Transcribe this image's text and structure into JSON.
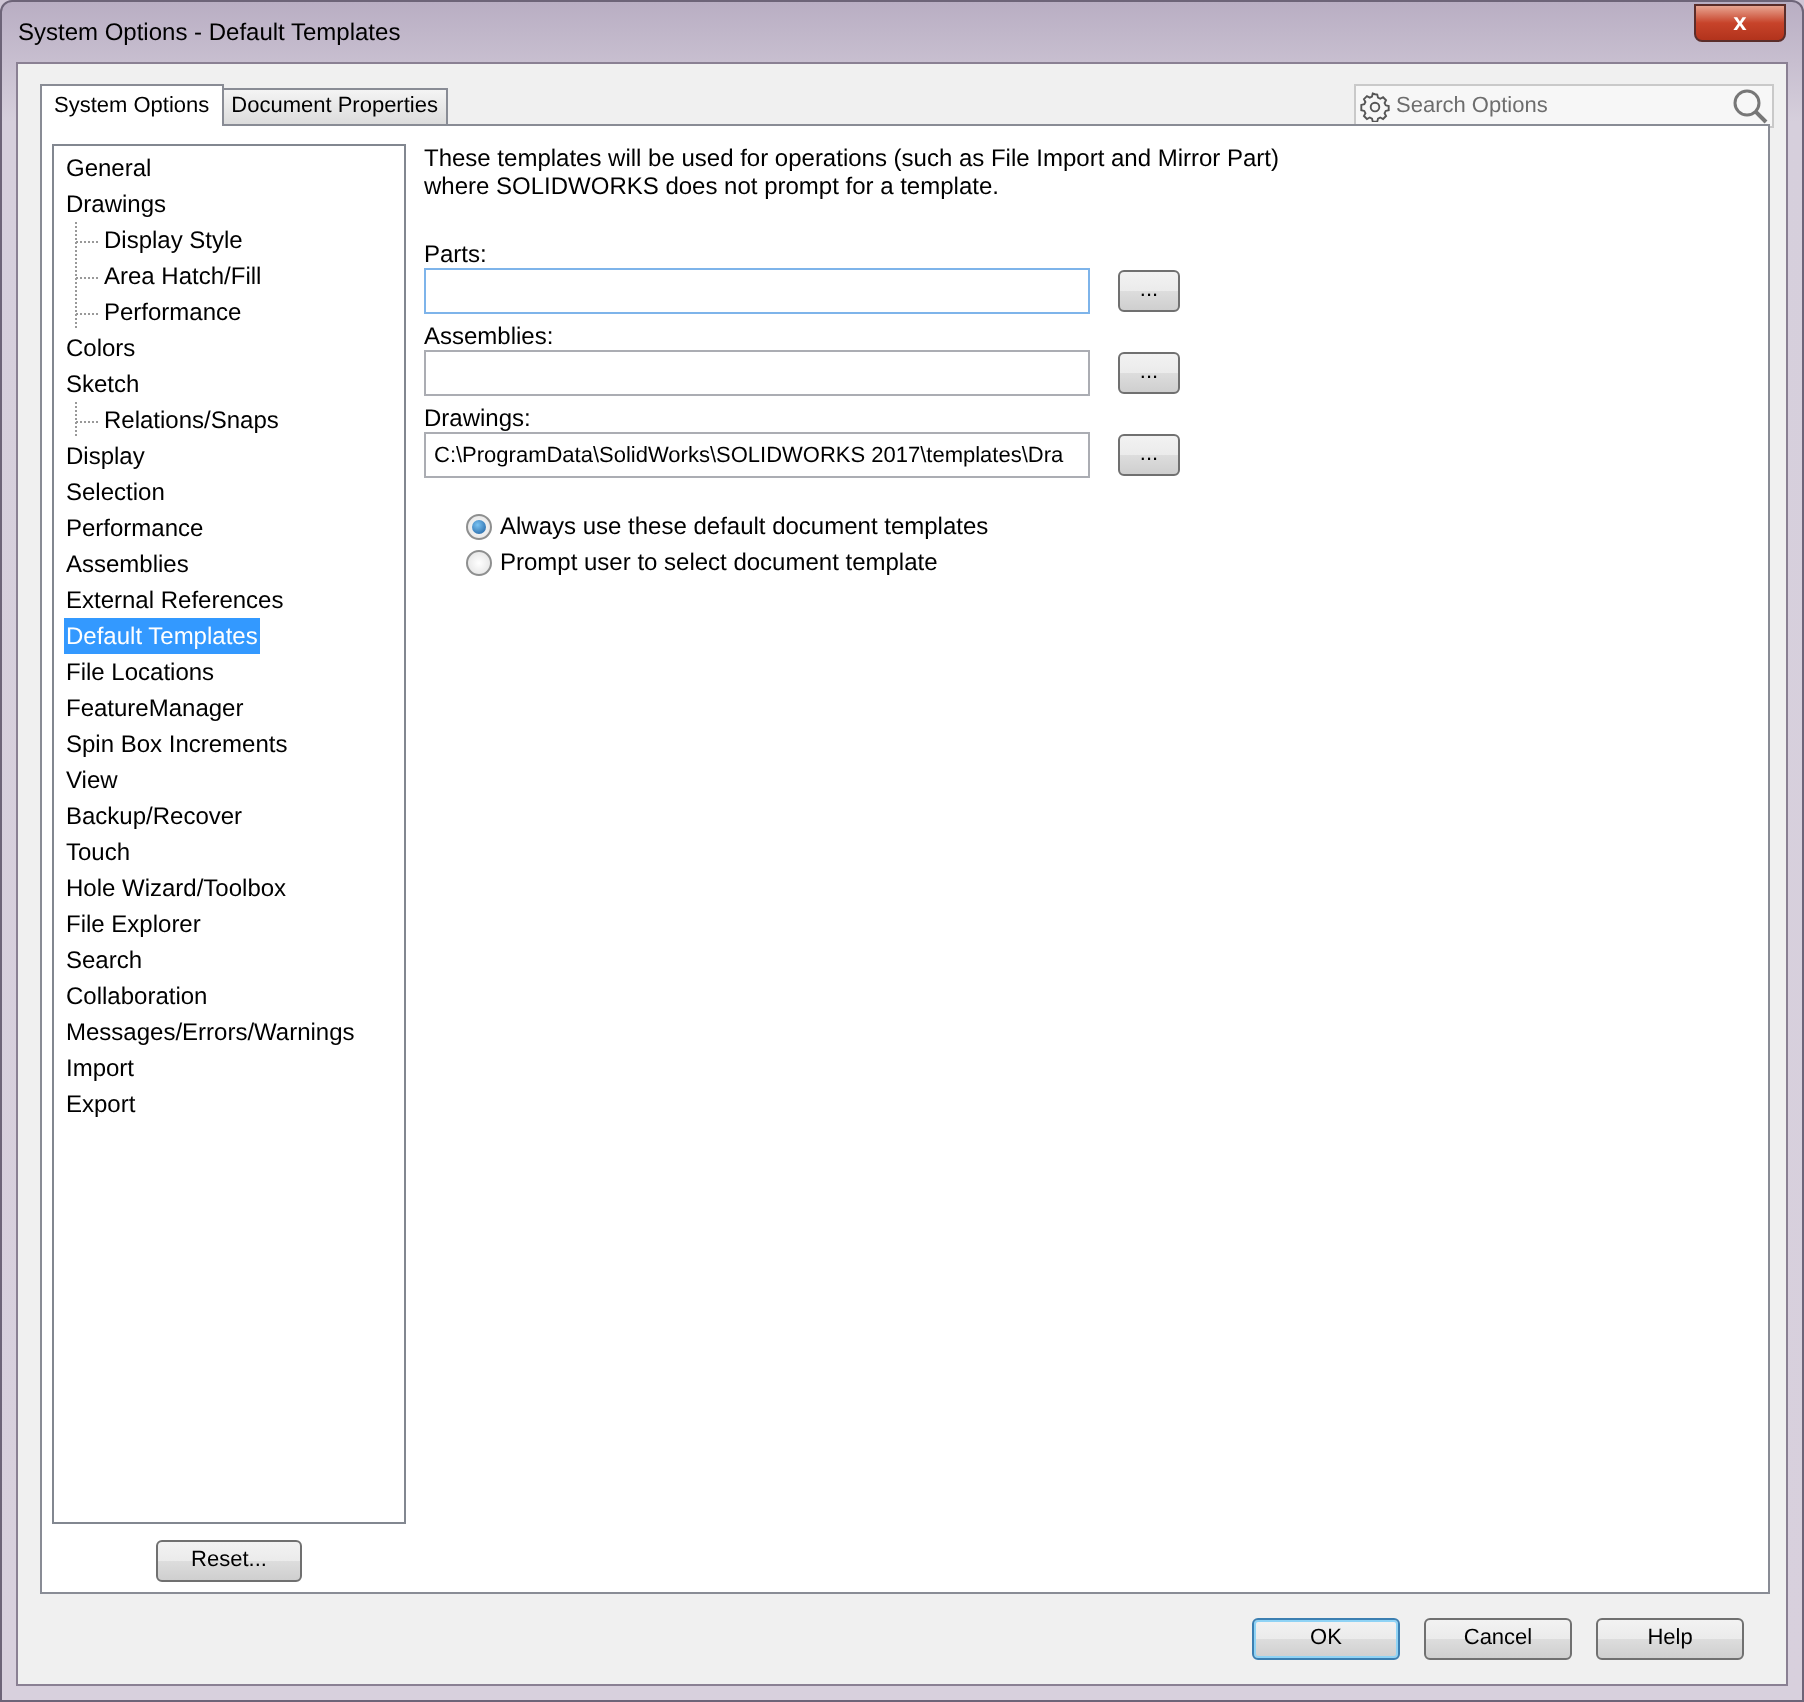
{
  "window": {
    "title": "System Options - Default Templates",
    "close_label": "x"
  },
  "tabs": [
    {
      "label": "System Options",
      "selected": true
    },
    {
      "label": "Document Properties",
      "selected": false
    }
  ],
  "search": {
    "placeholder": "Search Options"
  },
  "tree": [
    {
      "label": "General",
      "selected": false
    },
    {
      "label": "Drawings",
      "selected": false,
      "children": [
        {
          "label": "Display Style",
          "selected": false
        },
        {
          "label": "Area Hatch/Fill",
          "selected": false
        },
        {
          "label": "Performance",
          "selected": false
        }
      ]
    },
    {
      "label": "Colors",
      "selected": false
    },
    {
      "label": "Sketch",
      "selected": false,
      "children": [
        {
          "label": "Relations/Snaps",
          "selected": false
        }
      ]
    },
    {
      "label": "Display",
      "selected": false
    },
    {
      "label": "Selection",
      "selected": false
    },
    {
      "label": "Performance",
      "selected": false
    },
    {
      "label": "Assemblies",
      "selected": false
    },
    {
      "label": "External References",
      "selected": false
    },
    {
      "label": "Default Templates",
      "selected": true
    },
    {
      "label": "File Locations",
      "selected": false
    },
    {
      "label": "FeatureManager",
      "selected": false
    },
    {
      "label": "Spin Box Increments",
      "selected": false
    },
    {
      "label": "View",
      "selected": false
    },
    {
      "label": "Backup/Recover",
      "selected": false
    },
    {
      "label": "Touch",
      "selected": false
    },
    {
      "label": "Hole Wizard/Toolbox",
      "selected": false
    },
    {
      "label": "File Explorer",
      "selected": false
    },
    {
      "label": "Search",
      "selected": false
    },
    {
      "label": "Collaboration",
      "selected": false
    },
    {
      "label": "Messages/Errors/Warnings",
      "selected": false
    },
    {
      "label": "Import",
      "selected": false
    },
    {
      "label": "Export",
      "selected": false
    }
  ],
  "reset_button": "Reset...",
  "description": "These templates will be used for operations (such as File Import and Mirror Part)\nwhere SOLIDWORKS does not prompt for a template.",
  "fields": [
    {
      "label": "Parts:",
      "focused": true,
      "browse": "..."
    },
    {
      "label": "Assemblies:",
      "focused": false,
      "browse": "..."
    },
    {
      "label": "Drawings:",
      "value": "C:\\ProgramData\\SolidWorks\\SOLIDWORKS 2017\\templates\\Dra",
      "focused": false,
      "browse": "..."
    }
  ],
  "options": [
    {
      "label": "Always use these default document templates",
      "selected": true
    },
    {
      "label": "Prompt user to select document template",
      "selected": false
    }
  ],
  "buttons": [
    {
      "label": "OK",
      "default": true
    },
    {
      "label": "Cancel",
      "default": false
    },
    {
      "label": "Help",
      "default": false
    }
  ]
}
